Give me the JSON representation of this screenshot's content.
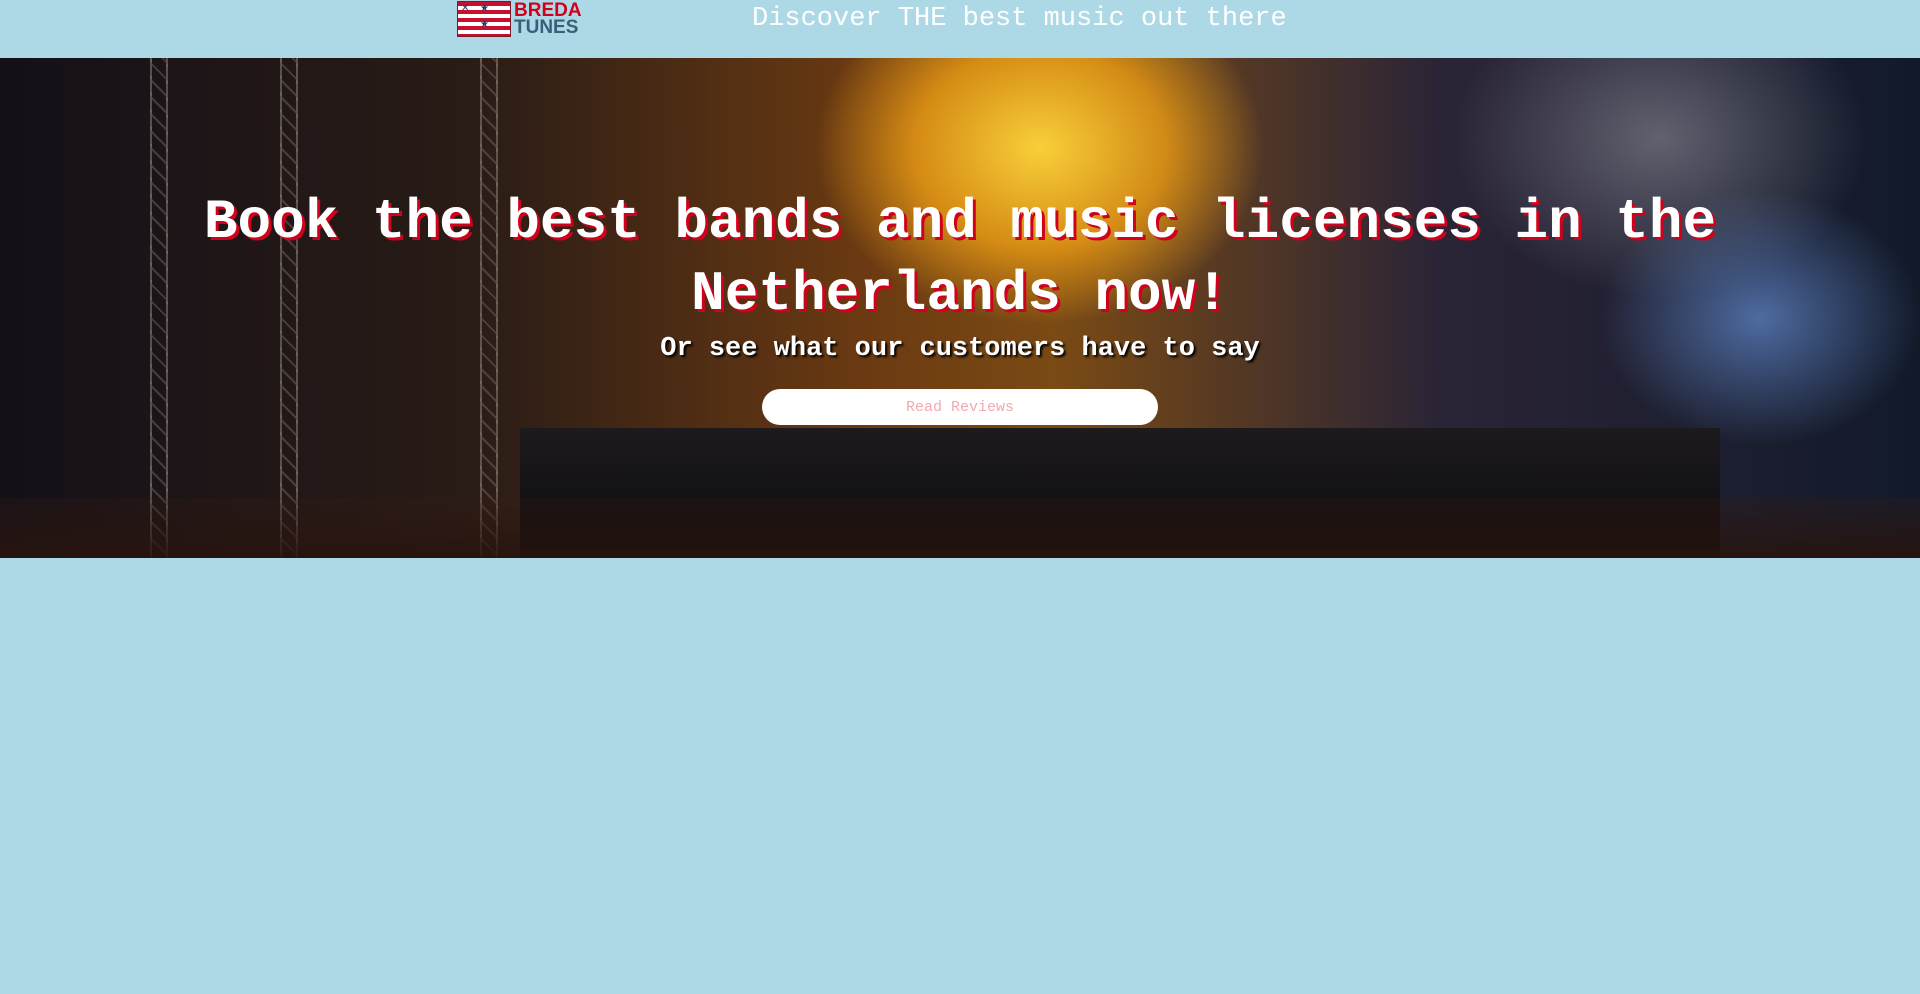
{
  "header": {
    "logo": {
      "line1": "BREDA",
      "line2": "TUNES"
    },
    "tagline": "Discover THE best music out there"
  },
  "hero": {
    "headline": "Book the best bands and music licenses in the Netherlands now!",
    "subheadline": "Or see what our customers have to say",
    "cta_label": "Read Reviews",
    "background_description_icon": "concert-photo"
  },
  "colors": {
    "page_background": "#add8e6",
    "headline_shadow": "#d0021b",
    "cta_text": "#f4a7ae",
    "cta_background": "#ffffff"
  }
}
